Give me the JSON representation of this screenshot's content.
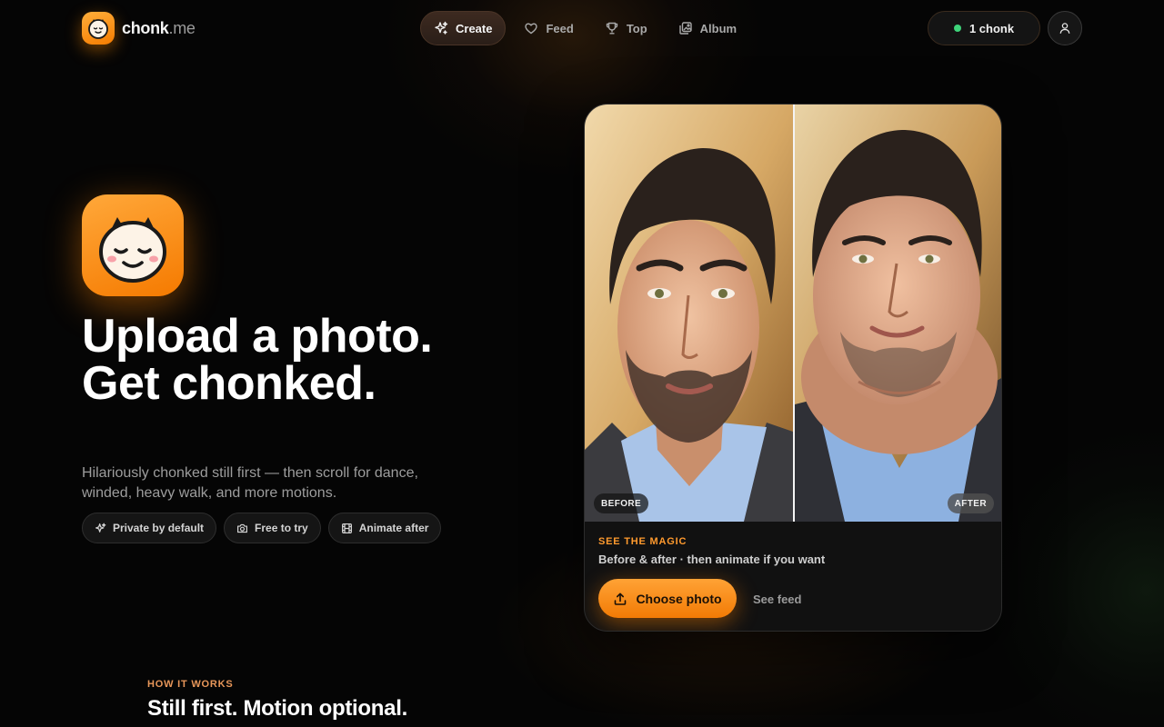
{
  "brand": {
    "name_main": "chonk",
    "name_suffix": ".me",
    "logo_icon": "smiling-face-icon"
  },
  "nav": {
    "items": [
      {
        "label": "Create",
        "icon": "sparkles-icon",
        "active": true
      },
      {
        "label": "Feed",
        "icon": "heart-icon",
        "active": false
      },
      {
        "label": "Top",
        "icon": "trophy-icon",
        "active": false
      },
      {
        "label": "Album",
        "icon": "album-icon",
        "active": false
      }
    ],
    "credits_label": "1 chonk",
    "credits_status_color": "#3ed47a",
    "user_icon": "user-icon"
  },
  "hero": {
    "headline": "Upload a photo. Get chonked.",
    "subhead": "Hilariously chonked still first — then scroll for dance, winded, heavy walk, and more motions.",
    "badges": [
      {
        "label": "Private by default",
        "icon": "sparkles-icon"
      },
      {
        "label": "Free to try",
        "icon": "camera-icon"
      },
      {
        "label": "Animate after",
        "icon": "film-icon"
      }
    ]
  },
  "card": {
    "before_tag": "BEFORE",
    "after_tag": "AFTER",
    "eyebrow": "SEE THE MAGIC",
    "caption": "Before & after · then animate if you want",
    "primary_button": "Choose photo",
    "secondary_link": "See feed"
  },
  "how_it_works": {
    "eyebrow": "HOW IT WORKS",
    "title": "Still first. Motion optional."
  },
  "colors": {
    "accent": "#f57c00",
    "accent_light": "#ffa83a",
    "background": "#050505"
  }
}
